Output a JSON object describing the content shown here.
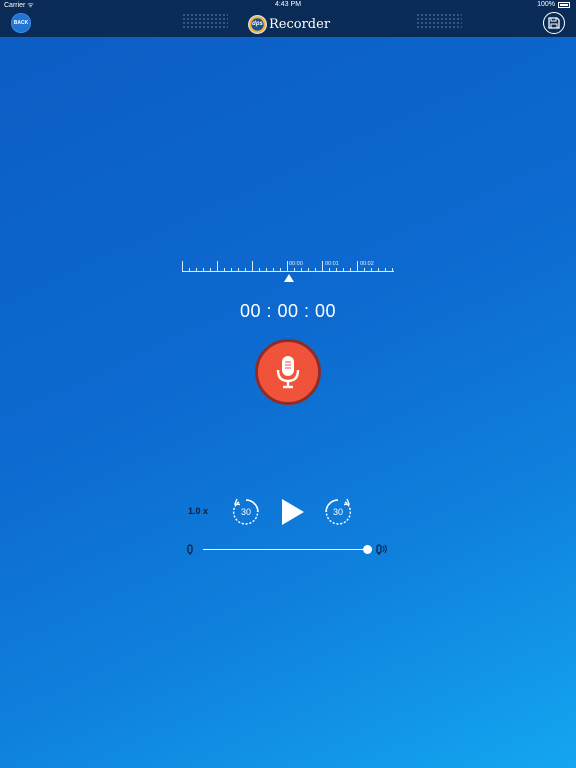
{
  "status_bar": {
    "carrier": "Carrier ᯤ",
    "time": "4:43 PM",
    "battery": "100%"
  },
  "nav": {
    "back_label": "BACK",
    "logo_text": "dps",
    "title": "Recorder"
  },
  "ruler": {
    "labels": [
      "00:00",
      "00:01",
      "00:02"
    ]
  },
  "timer": "00 : 00 : 00",
  "playback": {
    "speed": "1.0 x",
    "skip_back_seconds": "30",
    "skip_forward_seconds": "30"
  },
  "volume": {
    "level": 1.0
  },
  "colors": {
    "nav_bg": "#0b2b57",
    "record_red": "#f0533a",
    "record_ring": "#8d2d2a",
    "accent_blue": "#1f74d6"
  },
  "icons": {
    "record": "microphone-icon",
    "save": "save-icon",
    "play": "play-icon",
    "skip_back": "rewind-30-icon",
    "skip_forward": "forward-30-icon",
    "volume_low": "volume-low-icon",
    "volume_high": "volume-high-icon"
  }
}
